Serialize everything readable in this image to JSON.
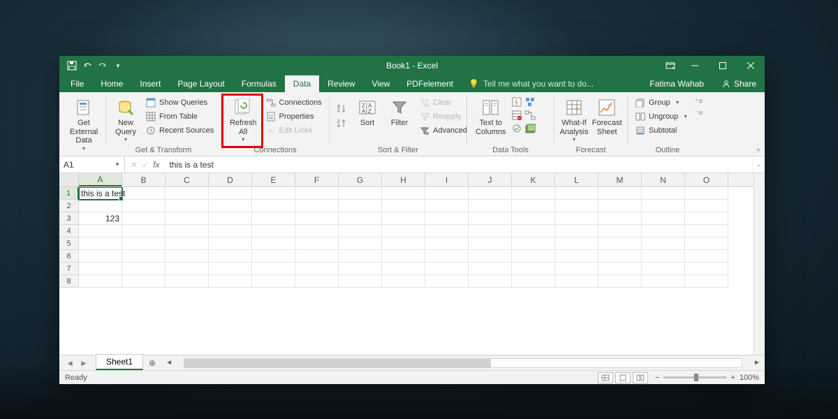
{
  "window": {
    "title": "Book1 - Excel",
    "user": "Fatima Wahab",
    "share": "Share",
    "tell_me": "Tell me what you want to do..."
  },
  "tabs": [
    "File",
    "Home",
    "Insert",
    "Page Layout",
    "Formulas",
    "Data",
    "Review",
    "View",
    "PDFelement"
  ],
  "active_tab": "Data",
  "ribbon": {
    "get_external": {
      "label": "Get External\nData"
    },
    "new_query": {
      "label": "New\nQuery"
    },
    "show_queries": "Show Queries",
    "from_table": "From Table",
    "recent_sources": "Recent Sources",
    "group_get_transform": "Get & Transform",
    "refresh_all": {
      "label": "Refresh\nAll"
    },
    "connections": "Connections",
    "properties": "Properties",
    "edit_links": "Edit Links",
    "group_connections": "Connections",
    "sort": "Sort",
    "filter": "Filter",
    "clear": "Clear",
    "reapply": "Reapply",
    "advanced": "Advanced",
    "group_sort_filter": "Sort & Filter",
    "text_to_columns": {
      "label": "Text to\nColumns"
    },
    "group_data_tools": "Data Tools",
    "what_if": {
      "label": "What-If\nAnalysis"
    },
    "forecast_sheet": {
      "label": "Forecast\nSheet"
    },
    "group_forecast": "Forecast",
    "group_btn": "Group",
    "ungroup_btn": "Ungroup",
    "subtotal_btn": "Subtotal",
    "group_outline": "Outline"
  },
  "formula": {
    "cell_ref": "A1",
    "value": "this is a test"
  },
  "columns": [
    "A",
    "B",
    "C",
    "D",
    "E",
    "F",
    "G",
    "H",
    "I",
    "J",
    "K",
    "L",
    "M",
    "N",
    "O"
  ],
  "rows": [
    1,
    2,
    3,
    4,
    5,
    6,
    7,
    8
  ],
  "cells": {
    "A1": "this is a test",
    "A3": "123"
  },
  "sheet": {
    "name": "Sheet1"
  },
  "status": {
    "ready": "Ready",
    "zoom": "100%"
  }
}
